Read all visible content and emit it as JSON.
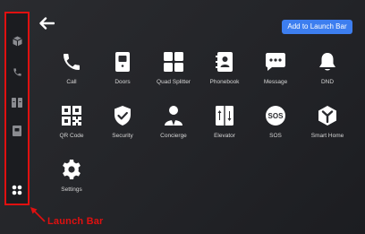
{
  "header": {
    "back_icon": "arrow-left-icon",
    "add_button_label": "Add to Launch Bar",
    "accent_color": "#3d7eef"
  },
  "sidebar": {
    "border_color": "#e01010",
    "items": [
      {
        "icon": "cube-icon"
      },
      {
        "icon": "phone-icon"
      },
      {
        "icon": "quad-split-icon"
      },
      {
        "icon": "door-icon"
      },
      {
        "icon": "apps-grid-icon"
      }
    ]
  },
  "apps": [
    {
      "label": "Call",
      "icon": "phone-icon"
    },
    {
      "label": "Doors",
      "icon": "door-icon"
    },
    {
      "label": "Quad Splitter",
      "icon": "quad-split-icon"
    },
    {
      "label": "Phonebook",
      "icon": "phonebook-icon"
    },
    {
      "label": "Message",
      "icon": "message-icon"
    },
    {
      "label": "DND",
      "icon": "bell-icon"
    },
    {
      "label": "QR Code",
      "icon": "qr-code-icon"
    },
    {
      "label": "Security",
      "icon": "shield-check-icon"
    },
    {
      "label": "Concierge",
      "icon": "concierge-icon"
    },
    {
      "label": "Elevator",
      "icon": "elevator-icon"
    },
    {
      "label": "SOS",
      "icon": "sos-icon"
    },
    {
      "label": "Smart Home",
      "icon": "smart-home-icon"
    },
    {
      "label": "Settings",
      "icon": "gear-icon"
    }
  ],
  "annotation": {
    "label": "Launch Bar",
    "color": "#e01010"
  }
}
